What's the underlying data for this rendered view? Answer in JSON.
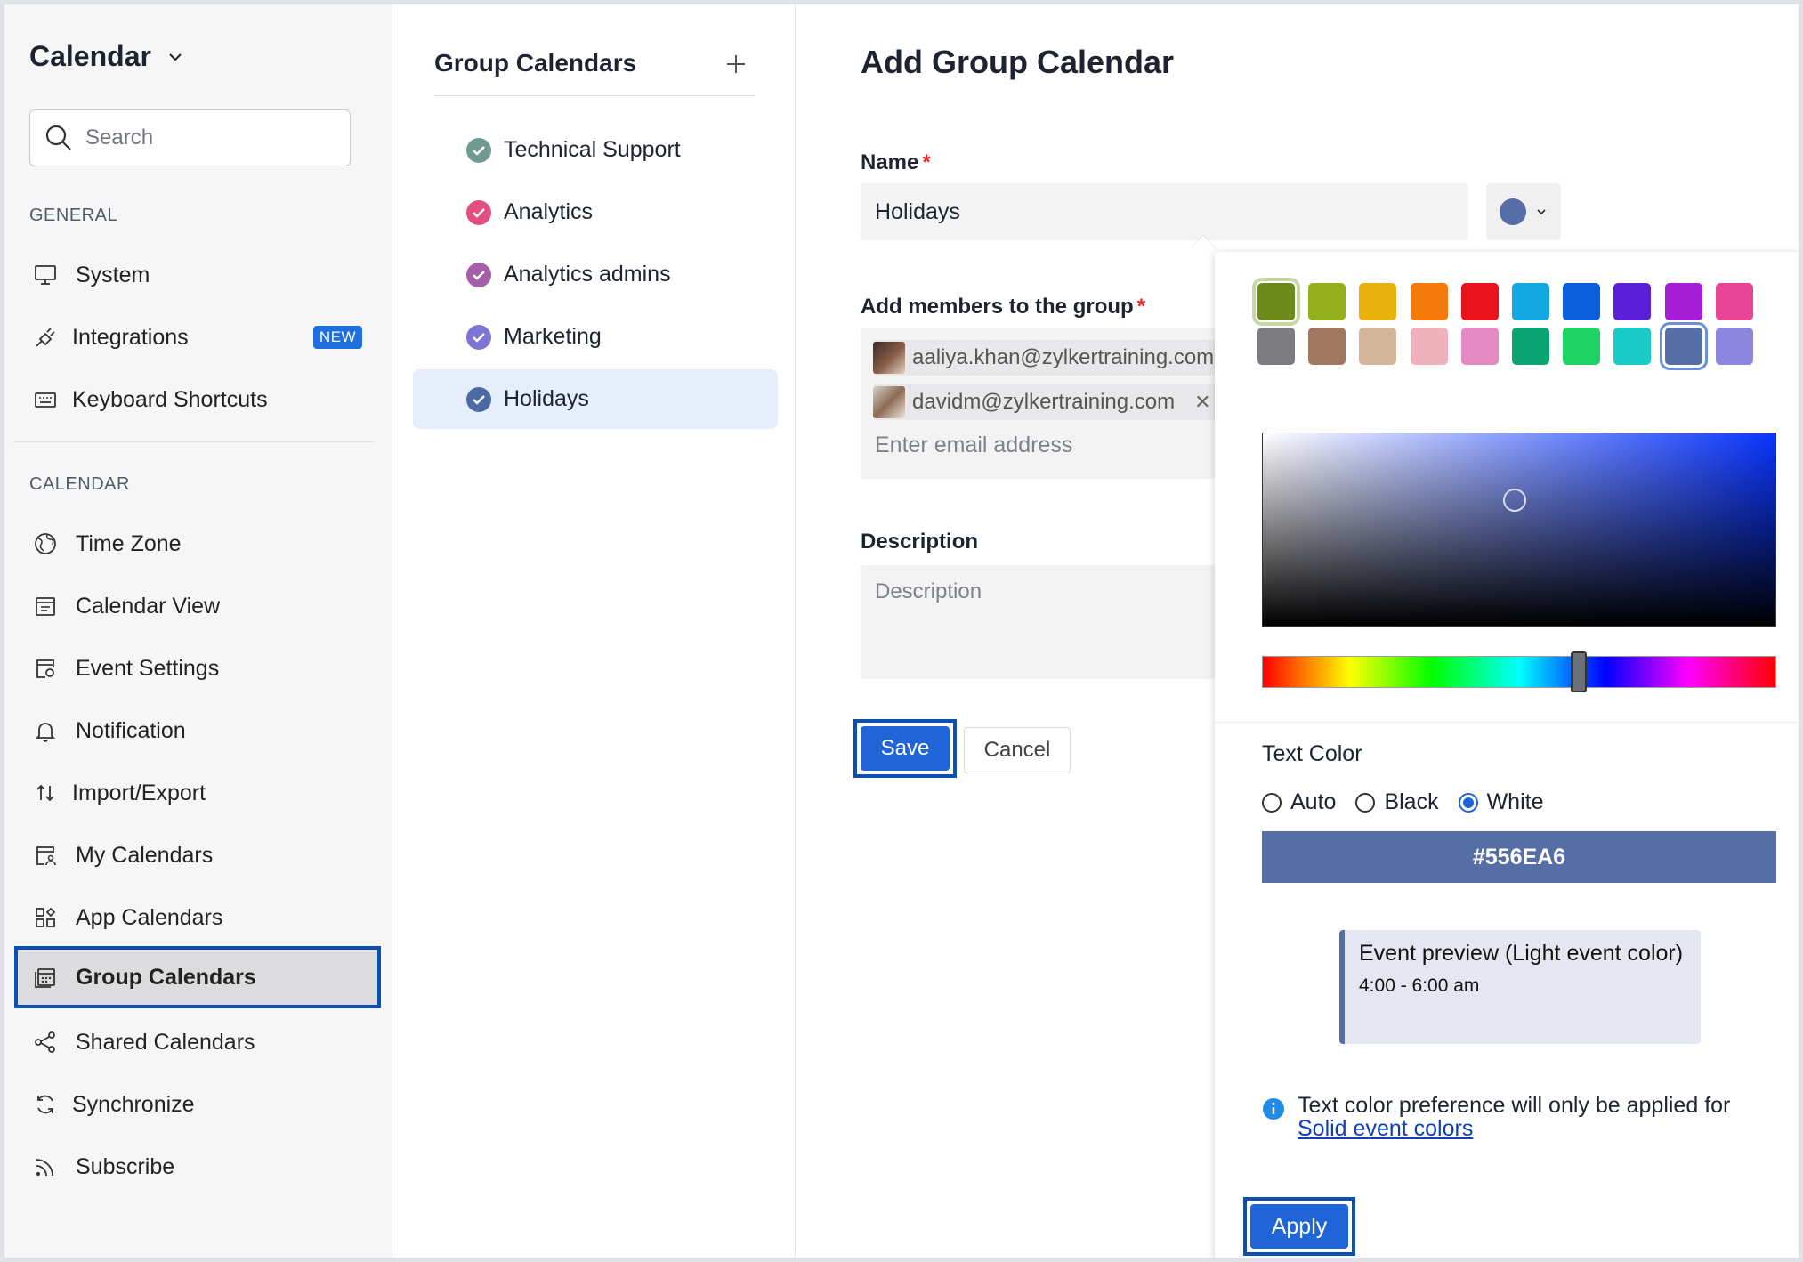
{
  "sidebar": {
    "app_title": "Calendar",
    "search_placeholder": "Search",
    "general_label": "GENERAL",
    "general_items": [
      {
        "label": "System"
      },
      {
        "label": "Integrations",
        "badge": "NEW"
      },
      {
        "label": "Keyboard Shortcuts"
      }
    ],
    "calendar_label": "CALENDAR",
    "calendar_items": [
      {
        "label": "Time Zone"
      },
      {
        "label": "Calendar View"
      },
      {
        "label": "Event Settings"
      },
      {
        "label": "Notification"
      },
      {
        "label": "Import/Export"
      },
      {
        "label": "My Calendars"
      },
      {
        "label": "App Calendars"
      },
      {
        "label": "Group Calendars",
        "active": true
      },
      {
        "label": "Shared Calendars"
      },
      {
        "label": "Synchronize"
      },
      {
        "label": "Subscribe"
      }
    ]
  },
  "groups": {
    "title": "Group Calendars",
    "items": [
      {
        "label": "Technical Support",
        "color": "#6f9a8f"
      },
      {
        "label": "Analytics",
        "color": "#e24f7e"
      },
      {
        "label": "Analytics admins",
        "color": "#a55ea8"
      },
      {
        "label": "Marketing",
        "color": "#7d74d6"
      },
      {
        "label": "Holidays",
        "color": "#4b6aa3",
        "active": true
      }
    ]
  },
  "form": {
    "title": "Add Group Calendar",
    "name_label": "Name",
    "name_value": "Holidays",
    "members_label": "Add members to the group",
    "members": [
      "aaliya.khan@zylkertraining.com",
      "davidm@zylkertraining.com"
    ],
    "email_placeholder": "Enter email address",
    "description_label": "Description",
    "description_placeholder": "Description",
    "required_mark": "*",
    "save_label": "Save",
    "cancel_label": "Cancel",
    "selected_color": "#556EA6"
  },
  "picker": {
    "swatches_row1": [
      "#6b8a1a",
      "#94b11b",
      "#e9b00e",
      "#f57a0a",
      "#e9131b",
      "#14a8e2",
      "#0a60dc",
      "#5a1fd6",
      "#a31ed6",
      "#e84597"
    ],
    "swatches_row2": [
      "#7b7b80",
      "#a07862",
      "#d3b699",
      "#efb1bb",
      "#e489c4",
      "#0aa372",
      "#1fd363",
      "#18cbc8",
      "#556EA6",
      "#8d86e0"
    ],
    "text_color_label": "Text Color",
    "text_color_options": [
      "Auto",
      "Black",
      "White"
    ],
    "text_color_selected": "White",
    "hex_value": "#556EA6",
    "preview_title": "Event preview (Light event color)",
    "preview_time": "4:00 - 6:00 am",
    "info_text": "Text color preference will only be applied for",
    "info_link": "Solid event colors",
    "apply_label": "Apply"
  }
}
